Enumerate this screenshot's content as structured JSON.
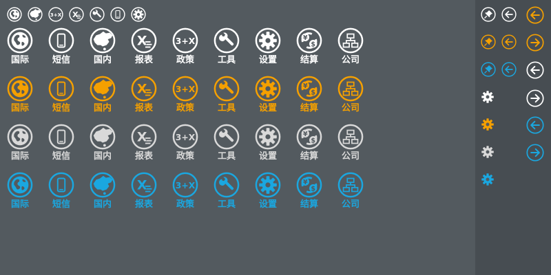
{
  "colors": {
    "white": "#ffffff",
    "orange": "#f5a000",
    "gray": "#d9d9d9",
    "blue": "#1aa7e0",
    "main_bg": "#535a5f",
    "side_bg": "#474d52"
  },
  "small_icons": [
    "globe-icon",
    "china-map-icon",
    "three-plus-x-icon",
    "x-chart-icon",
    "wrench-icon",
    "phone-icon",
    "gear-icon"
  ],
  "grid_icons": [
    "globe-icon",
    "phone-icon",
    "china-map-icon",
    "x-chart-icon",
    "three-plus-x-icon",
    "wrench-icon",
    "gear-icon",
    "yen-dollar-icon",
    "org-chart-icon"
  ],
  "labels": {
    "l0": "国际",
    "l1": "短信",
    "l2": "国内",
    "l3": "报表",
    "l4": "政策",
    "l5": "工具",
    "l6": "设置",
    "l7": "结算",
    "l8": "公司"
  },
  "icon_texts": {
    "three_plus_x": "3+X",
    "x_letter": "X",
    "yen": "¥",
    "dollar": "$"
  },
  "rows": [
    {
      "name": "white",
      "color": "#ffffff"
    },
    {
      "name": "orange",
      "color": "#f5a000"
    },
    {
      "name": "gray",
      "color": "#d9d9d9"
    },
    {
      "name": "blue",
      "color": "#1aa7e0"
    }
  ]
}
